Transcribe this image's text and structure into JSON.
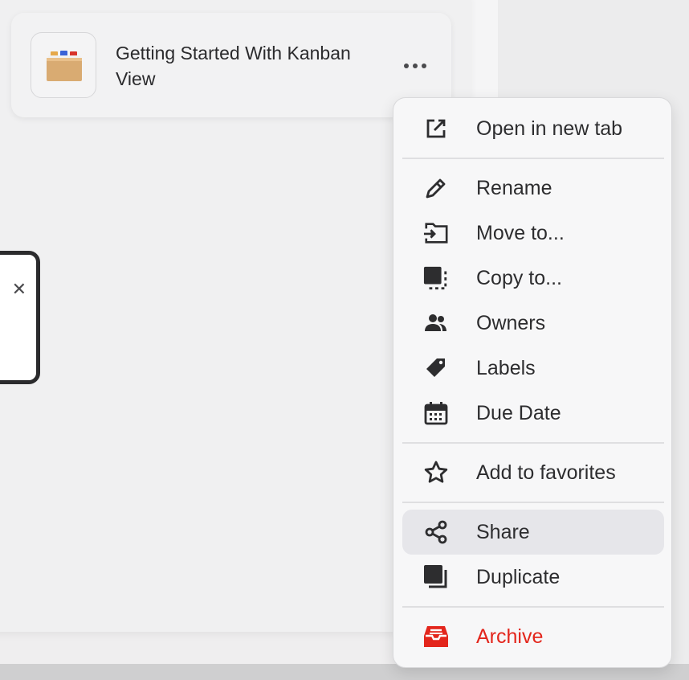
{
  "card": {
    "title": "Getting Started With Kanban View",
    "icon": "card-file-box-icon",
    "more_icon": "more-horizontal-icon"
  },
  "modal": {
    "close_icon": "close-icon"
  },
  "menu": {
    "items": [
      {
        "label": "Open in new tab",
        "icon": "open-external-icon"
      },
      {
        "label": "Rename",
        "icon": "pencil-icon"
      },
      {
        "label": "Move to...",
        "icon": "move-folder-icon"
      },
      {
        "label": "Copy to...",
        "icon": "copy-icon"
      },
      {
        "label": "Owners",
        "icon": "people-icon"
      },
      {
        "label": "Labels",
        "icon": "tag-icon"
      },
      {
        "label": "Due Date",
        "icon": "calendar-icon"
      },
      {
        "label": "Add to favorites",
        "icon": "star-icon"
      },
      {
        "label": "Share",
        "icon": "share-icon"
      },
      {
        "label": "Duplicate",
        "icon": "duplicate-icon"
      },
      {
        "label": "Archive",
        "icon": "archive-icon"
      }
    ]
  },
  "colors": {
    "danger": "#e3261c",
    "hover": "#e6e6ea",
    "text": "#2d2d2f"
  }
}
